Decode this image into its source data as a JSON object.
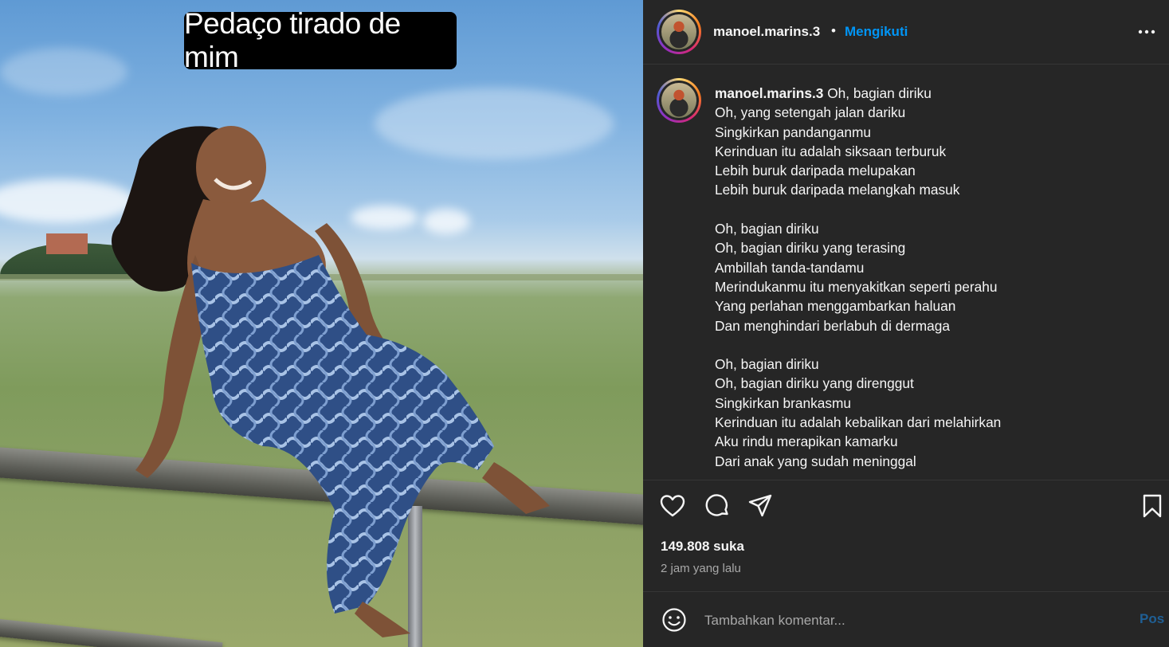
{
  "media": {
    "overlay_text": "Pedaço tirado de mim"
  },
  "header": {
    "username": "manoel.marins.3",
    "separator": "•",
    "follow_label": "Mengikuti"
  },
  "caption": {
    "username": "manoel.marins.3",
    "text": " Oh, bagian diriku\nOh, yang setengah jalan dariku\nSingkirkan pandanganmu\nKerinduan itu adalah siksaan terburuk\nLebih buruk daripada melupakan\nLebih buruk daripada melangkah masuk\n\nOh, bagian diriku\nOh, bagian diriku yang terasing\nAmbillah tanda-tandamu\nMerindukanmu itu menyakitkan seperti perahu\nYang perlahan menggambarkan haluan\nDan menghindari berlabuh di dermaga\n\nOh, bagian diriku\nOh, bagian diriku yang direnggut\nSingkirkan brankasmu\nKerinduan itu adalah kebalikan dari melahirkan\nAku rindu merapikan kamarku\nDari anak yang sudah meninggal"
  },
  "stats": {
    "likes": "149.808 suka",
    "time_ago": "2 jam yang lalu"
  },
  "comment": {
    "placeholder": "Tambahkan komentar...",
    "post_label": "Pos"
  },
  "icons": {
    "more": "more-options-icon",
    "like": "heart-icon",
    "comment": "comment-icon",
    "share": "share-icon",
    "save": "bookmark-icon",
    "emoji": "emoji-icon"
  },
  "colors": {
    "panel_bg": "#262626",
    "link_blue": "#0095f6",
    "muted": "#a8a8a8",
    "post_disabled": "#1f5f95"
  }
}
